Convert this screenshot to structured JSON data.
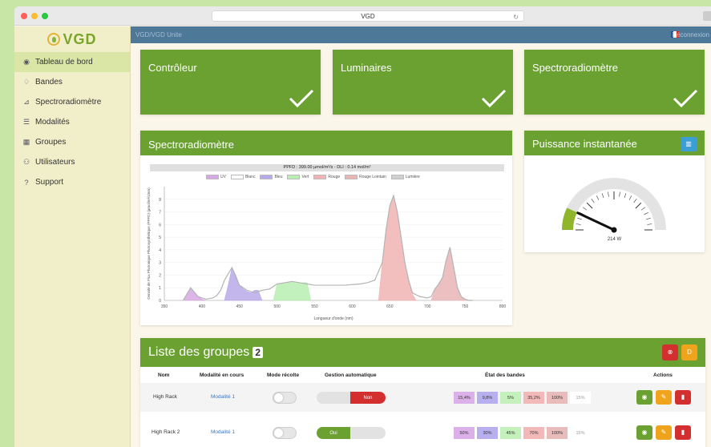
{
  "browser": {
    "url": "VGD"
  },
  "brand": {
    "name": "VGD"
  },
  "sidebar": {
    "items": [
      {
        "label": "Tableau de bord",
        "icon": "dashboard-icon"
      },
      {
        "label": "Bandes",
        "icon": "tag-icon"
      },
      {
        "label": "Spectroradiomètre",
        "icon": "chart-icon"
      },
      {
        "label": "Modalités",
        "icon": "list-icon"
      },
      {
        "label": "Groupes",
        "icon": "grid-icon"
      },
      {
        "label": "Utilisateurs",
        "icon": "users-icon"
      },
      {
        "label": "Support",
        "icon": "help-icon"
      }
    ]
  },
  "topbar": {
    "breadcrumb": "VGD/VGD Unite",
    "user": "Déconnexion"
  },
  "status_cards": [
    {
      "title": "Contrôleur",
      "ok": true
    },
    {
      "title": "Luminaires",
      "ok": true
    },
    {
      "title": "Spectroradiomètre",
      "ok": true
    }
  ],
  "spectro": {
    "title": "Spectroradiomètre"
  },
  "gauge": {
    "title": "Puissance instantanée",
    "value_label": "214 W",
    "fraction": 0.14
  },
  "groups": {
    "title": "Liste des groupes",
    "count": "2",
    "columns": [
      "Nom",
      "Modalité en cours",
      "Mode récolte",
      "Gestion automatique",
      "État des bandes",
      "Actions"
    ],
    "rows": [
      {
        "name": "High Rack",
        "modality": "Modalité 1",
        "auto_on": "",
        "auto_off": "Non",
        "bands": [
          "15,4%",
          "9,8%",
          "5%",
          "35,2%",
          "100%",
          "15%"
        ]
      },
      {
        "name": "High Rack 2",
        "modality": "Modalité 1",
        "auto_on": "Oui",
        "auto_off": "",
        "bands": [
          "50%",
          "30%",
          "45%",
          "70%",
          "100%",
          "15%"
        ]
      }
    ]
  },
  "colors": {
    "green": "#6aa131",
    "blue": "#4e7898",
    "red": "#d32f2f",
    "orange": "#f0a41c"
  },
  "chart_data": {
    "type": "area",
    "title": "PPFD : 399.00 µmol/m²/s - DLI : 0.14 mol/m²",
    "xlabel": "Longueur d'onde (nm)",
    "ylabel": "Densité de Flux Photonique Photosynthétique (PPFD) (µmol/m²/s/nm)",
    "xlim": [
      350,
      800
    ],
    "ylim": [
      0,
      9
    ],
    "xticks": [
      350,
      400,
      450,
      500,
      550,
      600,
      650,
      700,
      750,
      800
    ],
    "yticks": [
      0,
      1,
      2,
      3,
      4,
      5,
      6,
      7,
      8
    ],
    "legend": [
      "UV",
      "Blanc",
      "Bleu",
      "Vert",
      "Rouge",
      "Rouge Lointain",
      "Lumière"
    ],
    "legend_colors": [
      "#d7a9e3",
      "#ffffff",
      "#b7a9ea",
      "#b9eeb2",
      "#f1b3b3",
      "#e9b5b5",
      "#cfcfcf"
    ],
    "series": [
      {
        "name": "UV",
        "color": "#d7a9e3",
        "x": [
          375,
          380,
          385,
          390,
          395,
          400,
          405
        ],
        "y": [
          0,
          0.5,
          1.0,
          0.6,
          0.3,
          0.1,
          0
        ]
      },
      {
        "name": "Bleu",
        "color": "#b7a9ea",
        "x": [
          430,
          435,
          440,
          445,
          450,
          455,
          460,
          465,
          470,
          475,
          480
        ],
        "y": [
          0,
          1.2,
          2.6,
          2.0,
          1.2,
          0.9,
          0.7,
          0.6,
          0.8,
          0.8,
          0
        ]
      },
      {
        "name": "Vert",
        "color": "#b9eeb2",
        "x": [
          495,
          500,
          510,
          520,
          530,
          540,
          545
        ],
        "y": [
          0,
          1.3,
          1.4,
          1.5,
          1.4,
          1.4,
          0
        ]
      },
      {
        "name": "Rouge",
        "color": "#f1b3b3",
        "x": [
          635,
          640,
          645,
          650,
          655,
          660,
          665,
          670,
          675,
          680,
          685
        ],
        "y": [
          0,
          3.0,
          5.6,
          7.5,
          8.3,
          7.0,
          5.0,
          3.0,
          1.5,
          0.5,
          0
        ]
      },
      {
        "name": "Rouge Lointain",
        "color": "#e9b5b5",
        "x": [
          705,
          710,
          715,
          720,
          725,
          730,
          735,
          740,
          745,
          750
        ],
        "y": [
          0,
          0.8,
          1.2,
          1.8,
          3.2,
          4.2,
          2.6,
          1.0,
          0.3,
          0
        ]
      },
      {
        "name": "Lumière",
        "color": "#b4b4b4",
        "x": [
          375,
          385,
          395,
          405,
          415,
          420,
          425,
          430,
          440,
          450,
          460,
          470,
          480,
          490,
          500,
          510,
          520,
          530,
          540,
          550,
          560,
          570,
          580,
          590,
          600,
          610,
          620,
          630,
          640,
          645,
          650,
          655,
          660,
          665,
          670,
          675,
          680,
          690,
          700,
          705,
          710,
          715,
          720,
          725,
          730,
          735,
          740,
          745,
          750,
          755,
          760
        ],
        "y": [
          0,
          1.0,
          0.3,
          0.1,
          0.2,
          0.4,
          0.8,
          1.6,
          2.6,
          1.2,
          0.8,
          0.6,
          0.8,
          0.9,
          1.3,
          1.4,
          1.5,
          1.4,
          1.3,
          1.2,
          1.2,
          1.2,
          1.2,
          1.2,
          1.25,
          1.3,
          1.4,
          1.6,
          3.0,
          5.6,
          7.5,
          8.3,
          7.0,
          5.0,
          3.0,
          1.6,
          0.6,
          0.3,
          0.2,
          0.3,
          0.9,
          1.3,
          1.8,
          3.2,
          4.2,
          2.6,
          1.0,
          0.3,
          0.1,
          0,
          0
        ]
      }
    ]
  }
}
